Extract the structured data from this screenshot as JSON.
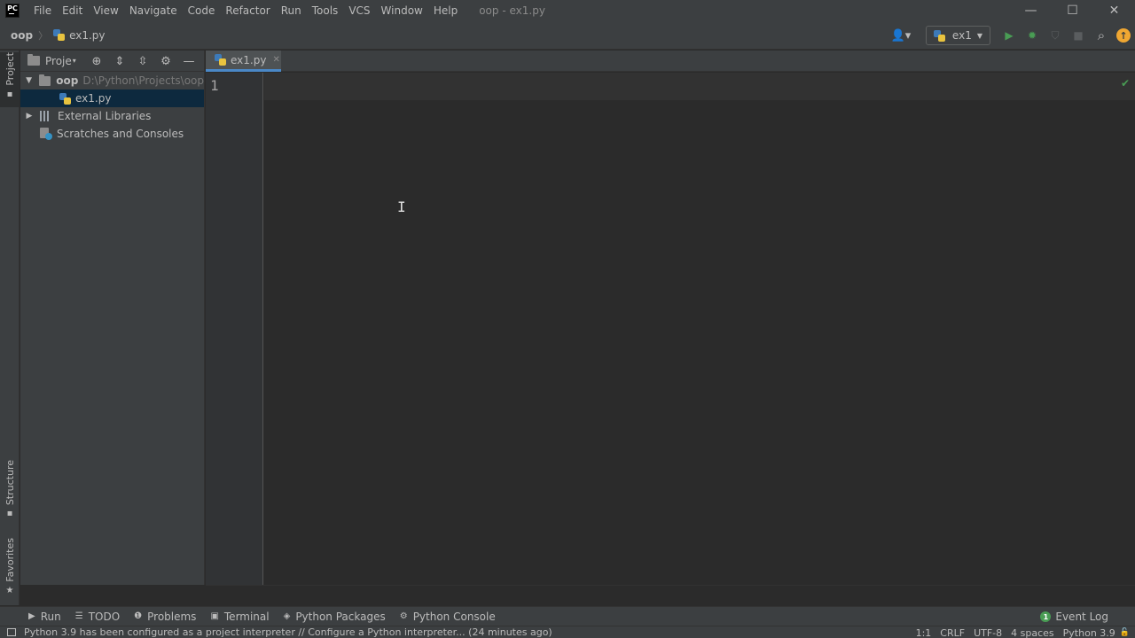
{
  "app": {
    "logo_text": "PC",
    "window_title": "oop - ex1.py"
  },
  "menu": [
    "File",
    "Edit",
    "View",
    "Navigate",
    "Code",
    "Refactor",
    "Run",
    "Tools",
    "VCS",
    "Window",
    "Help"
  ],
  "window_controls": {
    "minimize": "—",
    "maximize": "☐",
    "close": "✕"
  },
  "breadcrumbs": {
    "project": "oop",
    "file": "ex1.py"
  },
  "toolbar": {
    "run_config": "ex1",
    "run_config_dropdown": "▼",
    "user_icon": "👤▾",
    "run_icon": "▶",
    "debug_icon": "✹",
    "coverage_icon": "⛉",
    "stop_icon": "■",
    "search_icon": "⌕",
    "update_icon": "↑"
  },
  "left_stripe": {
    "project": "Project",
    "structure": "Structure",
    "favorites": "Favorites",
    "favorites_icon": "★",
    "structure_icon": "▪",
    "project_icon": "▪"
  },
  "project_panel": {
    "title": "Proje",
    "dropdown": "▾",
    "tools": {
      "locate": "⊕",
      "expand": "⇕",
      "collapse": "⇳",
      "settings": "⚙",
      "hide": "—"
    },
    "tree": {
      "root_arrow": "▼",
      "root_name": "oop",
      "root_path": "D:\\Python\\Projects\\oop",
      "file": "ex1.py",
      "libs_arrow": "▶",
      "libs": "External Libraries",
      "scratches": "Scratches and Consoles"
    }
  },
  "editor": {
    "tab_label": "ex1.py",
    "tab_close": "✕",
    "line_number": "1",
    "inspection_icon": "✔",
    "cursor_glyph": "I"
  },
  "bottom_tools": [
    {
      "icon": "▶",
      "label": "Run"
    },
    {
      "icon": "☰",
      "label": "TODO"
    },
    {
      "icon": "❶",
      "label": "Problems"
    },
    {
      "icon": "▣",
      "label": "Terminal"
    },
    {
      "icon": "◈",
      "label": "Python Packages"
    },
    {
      "icon": "⚙",
      "label": "Python Console"
    }
  ],
  "event_log": {
    "badge": "1",
    "label": "Event Log"
  },
  "status": {
    "message": "Python 3.9 has been configured as a project interpreter // Configure a Python interpreter... (24 minutes ago)",
    "position": "1:1",
    "line_sep": "CRLF",
    "encoding": "UTF-8",
    "indent": "4 spaces",
    "interpreter": "Python 3.9",
    "lock_icon": "🔓"
  }
}
